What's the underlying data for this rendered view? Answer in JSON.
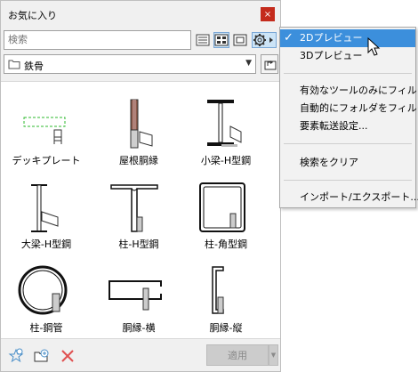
{
  "window": {
    "title": "お気に入り",
    "close_label": "×"
  },
  "search": {
    "placeholder": "検索"
  },
  "folder": {
    "name": "鉄骨"
  },
  "toolbar": {
    "icons": [
      "list-view-icon",
      "grid-view-icon",
      "preview-icon",
      "gear-icon"
    ]
  },
  "items": [
    {
      "label": "デッキプレート"
    },
    {
      "label": "屋根胴縁"
    },
    {
      "label": "小梁-H型鋼"
    },
    {
      "label": "大梁-H型鋼"
    },
    {
      "label": "柱-H型鋼"
    },
    {
      "label": "柱-角型鋼"
    },
    {
      "label": "柱-鋼管"
    },
    {
      "label": "胴縁-横"
    },
    {
      "label": "胴縁-縦"
    }
  ],
  "bottom": {
    "apply_label": "適用",
    "dropdown_glyph": "▼"
  },
  "menu": {
    "check_glyph": "✓",
    "items": [
      {
        "label": "2Dプレビュー",
        "checked": true,
        "highlighted": true
      },
      {
        "label": "3Dプレビュー",
        "checked": false,
        "highlighted": false
      },
      {
        "label": "有効なツールのみにフィルタ",
        "checked": false,
        "highlighted": false
      },
      {
        "label": "自動的にフォルダをフィルタ",
        "checked": false,
        "highlighted": false
      },
      {
        "label": "要素転送設定...",
        "checked": false,
        "highlighted": false
      },
      {
        "label": "検索をクリア",
        "checked": false,
        "highlighted": false
      },
      {
        "label": "インポート/エクスポート...",
        "checked": false,
        "highlighted": false
      }
    ]
  },
  "colors": {
    "close_red": "#c42b1c",
    "menu_highlight": "#3c8fdc",
    "active_toggle": "#cce4f7",
    "deck_green": "#2db82d",
    "roof_brown": "#8b5a4a",
    "delete_red": "#e05050"
  }
}
